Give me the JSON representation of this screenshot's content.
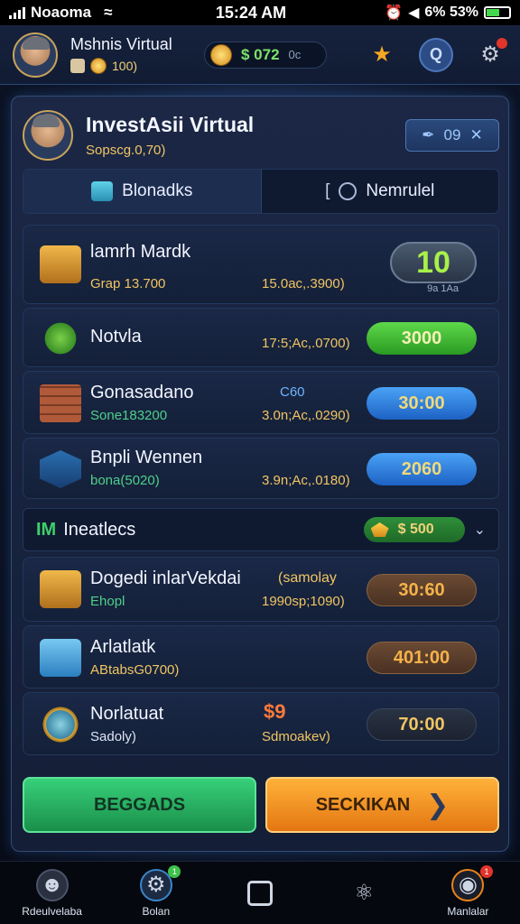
{
  "status": {
    "carrier": "Noaoma",
    "time": "15:24 AM",
    "battery_text": "6% 53%",
    "battery_level": 0.53
  },
  "header": {
    "name": "Mshnis Virtual",
    "sub_value": "100)",
    "balance": "$ 072",
    "balance_suffix": "0c"
  },
  "profile": {
    "title": "InvestAsii Virtual",
    "subtitle": "Sopscg.0,70)",
    "button_label": "09"
  },
  "tabs": [
    {
      "label": "Blonadks"
    },
    {
      "label": "Nemrulel"
    }
  ],
  "stocks": [
    {
      "name": "lamrh Mardk",
      "sub": "Grap 13.700",
      "mid": "15.0ac,.3900)",
      "value": "10",
      "caption": "9a 1Aa"
    },
    {
      "name": "Notvla",
      "sub": "",
      "mid": "17:5;Ac,.0700)",
      "value": "3000"
    },
    {
      "name": "Gonasadano",
      "sub": "Sone183200",
      "mid_top": "C60",
      "mid": "3.0n;Ac,.0290)",
      "value": "30:00"
    },
    {
      "name": "Bnpli Wennen",
      "sub": "bona(5020)",
      "mid": "3.9n;Ac,.0180)",
      "value": "2060"
    }
  ],
  "section": {
    "tag": "IM",
    "title": "Ineatlecs",
    "chip_value": "$ 500"
  },
  "markets": [
    {
      "name": "Dogedi inlarVekdai",
      "name_extra": "(samolay",
      "sub": "Ehopl",
      "mid": "1990sp;1090)",
      "value": "30:60"
    },
    {
      "name": "Arlatlatk",
      "sub": "ABtabsG0700)",
      "mid": "",
      "value": "401:00"
    },
    {
      "name": "Norlatuat",
      "sub": "Sadoly)",
      "mid_top": "$9",
      "mid": "Sdmoakev)",
      "value": "70:00"
    }
  ],
  "actions": {
    "left": "BEGGADS",
    "right": "SECKIKAN"
  },
  "nav": [
    {
      "label": "Rdeulvelaba",
      "icon": "avatar-icon"
    },
    {
      "label": "Bolan",
      "icon": "gear-icon",
      "badge": "1"
    },
    {
      "label": "",
      "icon": "square-icon"
    },
    {
      "label": "",
      "icon": "share-icon"
    },
    {
      "label": "Manlalar",
      "icon": "target-icon",
      "badge": "1"
    }
  ]
}
